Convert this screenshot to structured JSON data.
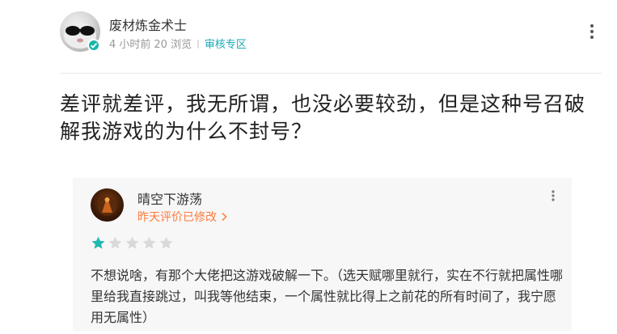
{
  "post": {
    "author": "废材炼金术士",
    "time": "4 小时前",
    "views": "20 浏览",
    "zone": "审核专区",
    "body": "差评就差评，我无所谓，也没必要较劲，但是这种号召破解我游戏的为什么不封号？"
  },
  "review": {
    "user": "晴空下游荡",
    "edited": "昨天评价已修改",
    "rating": 1,
    "max_rating": 5,
    "text": "不想说啥，有那个大佬把这游戏破解一下。（选天赋哪里就行，实在不行就把属性哪里给我直接跳过，叫我等他结束，一个属性就比得上之前花的所有时间了，我宁愿用无属性）"
  },
  "colors": {
    "accent": "#19a9b5",
    "edited": "#ff7a3a",
    "star_on": "#1fb8b0",
    "star_off": "#d9d9d9"
  },
  "icons": [
    "more-icon",
    "verified-icon",
    "chevron-right-icon",
    "star-icon"
  ]
}
